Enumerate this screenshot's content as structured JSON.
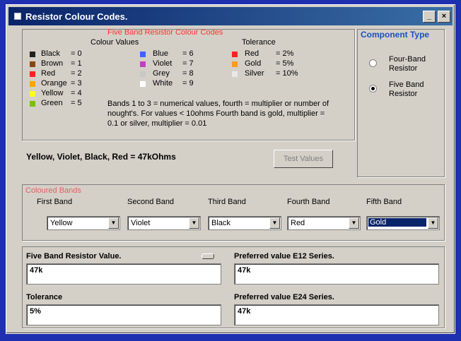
{
  "window": {
    "title": "Resistor Colour Codes."
  },
  "codes": {
    "heading": "Five Band Resistor Colour Codes",
    "colour_values_label": "Colour Values",
    "tolerance_label": "Tolerance",
    "colours": [
      {
        "name": "Black",
        "value": "= 0",
        "color": "#202020"
      },
      {
        "name": "Brown",
        "value": "= 1",
        "color": "#8b4513"
      },
      {
        "name": "Red",
        "value": "= 2",
        "color": "#ff2020"
      },
      {
        "name": "Orange",
        "value": "= 3",
        "color": "#ffa500"
      },
      {
        "name": "Yellow",
        "value": "= 4",
        "color": "#ffff20"
      },
      {
        "name": "Green",
        "value": "= 5",
        "color": "#7cc000"
      },
      {
        "name": "Blue",
        "value": "= 6",
        "color": "#4060ff"
      },
      {
        "name": "Violet",
        "value": "= 7",
        "color": "#c040c0"
      },
      {
        "name": "Grey",
        "value": "= 8",
        "color": "#c8c8c8"
      },
      {
        "name": "White",
        "value": "= 9",
        "color": "#ffffff"
      }
    ],
    "tolerances": [
      {
        "name": "Red",
        "value": "= 2%",
        "color": "#ff2020"
      },
      {
        "name": "Gold",
        "value": "= 5%",
        "color": "#ff9a20"
      },
      {
        "name": "Silver",
        "value": "= 10%",
        "color": "#e8e8e8"
      }
    ],
    "note": "Bands 1 to 3 = numerical values, fourth = multiplier or number of nought's. For values < 10ohms Fourth band is gold, multiplier = 0.1 or silver, multiplier = 0.01"
  },
  "component_type": {
    "title": "Component Type",
    "options": [
      {
        "label": "Four-Band Resistor",
        "selected": false
      },
      {
        "label": "Five Band Resistor",
        "selected": true
      }
    ]
  },
  "result_line": "Yellow, Violet, Black, Red  = 47kOhms",
  "test_button": "Test Values",
  "bands": {
    "title": "Coloured Bands",
    "items": [
      {
        "label": "First Band",
        "value": "Yellow"
      },
      {
        "label": "Second Band",
        "value": "Violet"
      },
      {
        "label": "Third Band",
        "value": "Black"
      },
      {
        "label": "Fourth Band",
        "value": "Red"
      },
      {
        "label": "Fifth Band",
        "value": "Gold"
      }
    ]
  },
  "outputs": {
    "resistor_value_label": "Five Band Resistor Value.",
    "resistor_value": "47k",
    "tolerance_label": "Tolerance",
    "tolerance": "5%",
    "e12_label": "Preferred value E12 Series.",
    "e12": "47k",
    "e24_label": "Preferred value E24 Series.",
    "e24": "47k"
  }
}
